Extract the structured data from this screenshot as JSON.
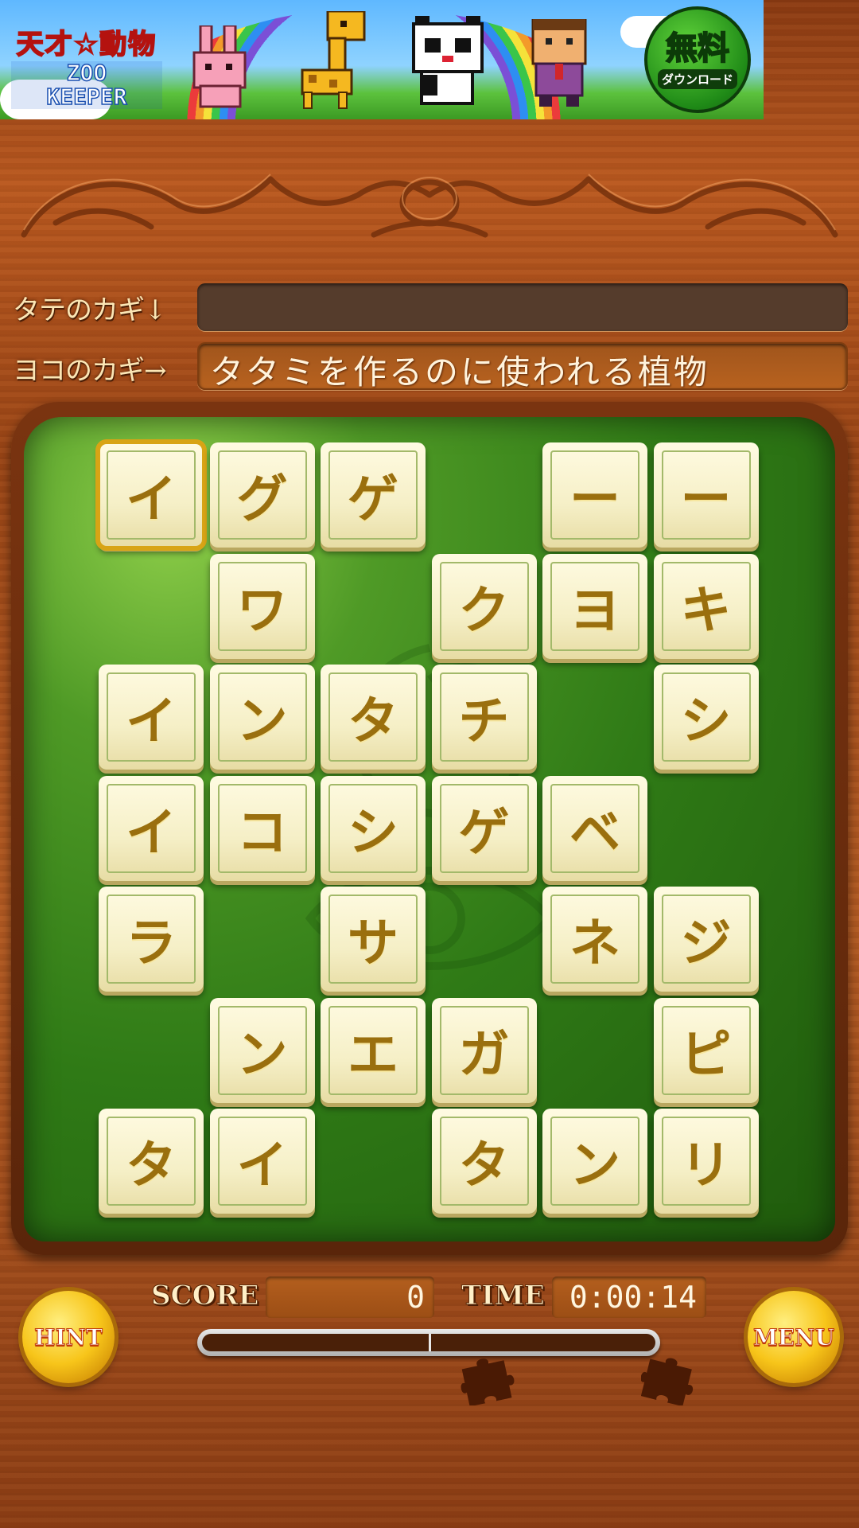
{
  "banner": {
    "logo_top": "天才☆動物",
    "logo_line1": "ZOO",
    "logo_line2": "KEEPER",
    "badge_big": "無料",
    "badge_small": "ダウンロード"
  },
  "clues": {
    "vertical_label": "タテのカギ↓",
    "vertical_text": "",
    "horizontal_label": "ヨコのカギ→",
    "horizontal_text": "タタミを作るのに使われる植物"
  },
  "grid": {
    "rows": [
      [
        "イ",
        "グ",
        "ゲ",
        "",
        "ー",
        "ー"
      ],
      [
        "",
        "ワ",
        "",
        "ク",
        "ヨ",
        "キ"
      ],
      [
        "イ",
        "ン",
        "タ",
        "チ",
        "",
        "シ"
      ],
      [
        "イ",
        "コ",
        "シ",
        "ゲ",
        "ベ",
        ""
      ],
      [
        "ラ",
        "",
        "サ",
        "",
        "ネ",
        "ジ"
      ],
      [
        "",
        "ン",
        "エ",
        "ガ",
        "",
        "ピ"
      ],
      [
        "タ",
        "イ",
        "",
        "タ",
        "ン",
        "リ"
      ]
    ],
    "selected": [
      0,
      0
    ]
  },
  "status": {
    "score_label": "SCORE",
    "score_value": "0",
    "time_label": "TIME",
    "time_value": "0:00:14",
    "progress": 0.5
  },
  "buttons": {
    "hint": "HINT",
    "menu": "MENU"
  }
}
